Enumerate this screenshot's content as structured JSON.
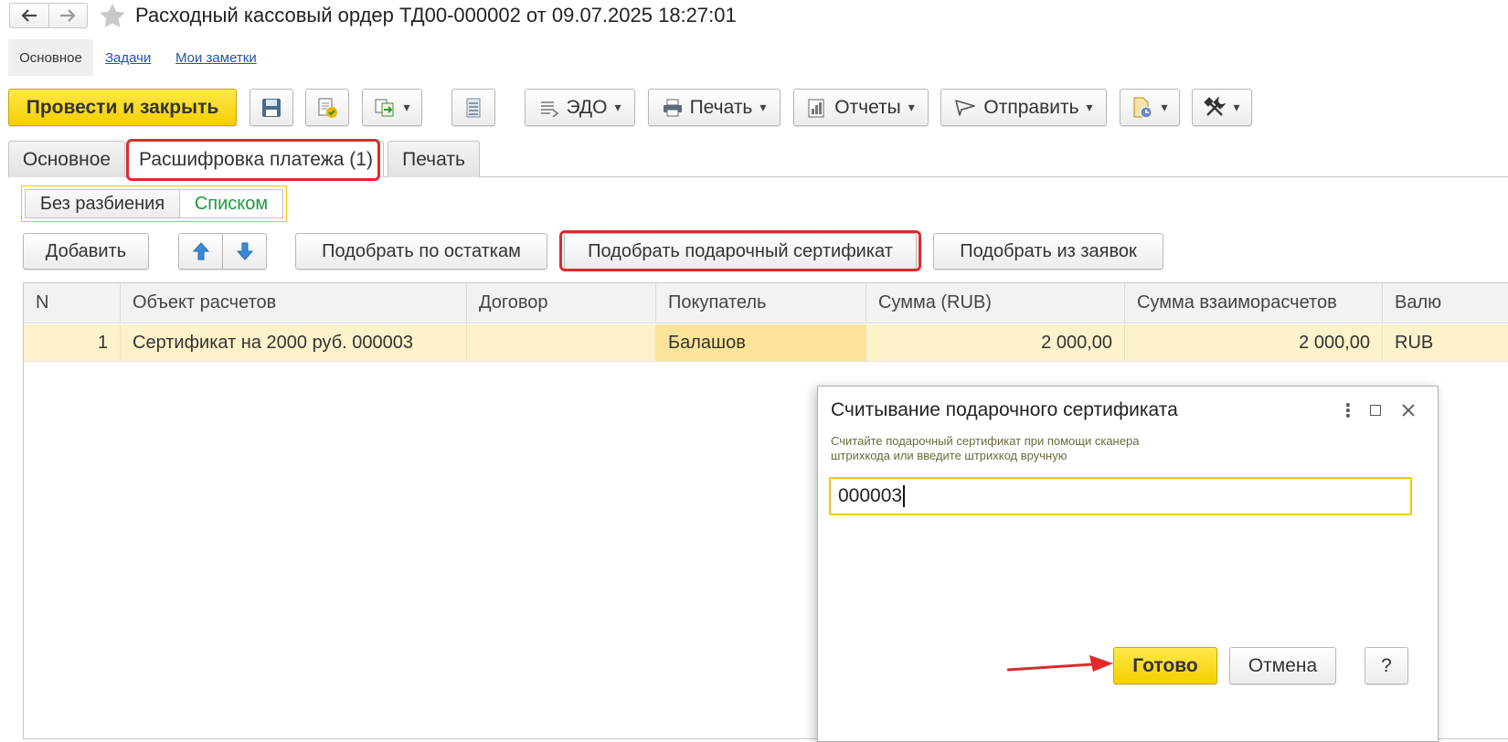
{
  "window": {
    "title": "Расходный кассовый ордер ТД00-000002 от 09.07.2025 18:27:01",
    "back_icon": "arrow-left-icon",
    "forward_icon": "arrow-right-icon",
    "favorite_icon": "star-icon"
  },
  "section_tabs": [
    {
      "label": "Основное"
    },
    {
      "label": "Задачи"
    },
    {
      "label": "Мои заметки"
    }
  ],
  "toolbar": {
    "post_close_label": "Провести и закрыть",
    "edo_label": "ЭДО",
    "print_label": "Печать",
    "reports_label": "Отчеты",
    "send_label": "Отправить"
  },
  "form_tabs": [
    {
      "label": "Основное"
    },
    {
      "label": "Расшифровка платежа (1)"
    },
    {
      "label": "Печать"
    }
  ],
  "mode_switch": {
    "without_split": "Без разбиения",
    "list": "Списком"
  },
  "table_toolbar": {
    "add_label": "Добавить",
    "pick_balance_label": "Подобрать по остаткам",
    "pick_certificate_label": "Подобрать подарочный сертификат",
    "pick_requests_label": "Подобрать из заявок"
  },
  "table": {
    "columns": [
      "N",
      "Объект расчетов",
      "Договор",
      "Покупатель",
      "Сумма (RUB)",
      "Сумма взаиморасчетов",
      "Валю"
    ],
    "rows": [
      {
        "n": "1",
        "object": "Сертификат на 2000 руб. 000003",
        "contract": "",
        "buyer": "Балашов",
        "amount": "2 000,00",
        "settlement": "2 000,00",
        "currency": "RUB"
      }
    ]
  },
  "dialog": {
    "title": "Считывание подарочного сертификата",
    "hint_line1": "Считайте подарочный сертификат при помощи сканера",
    "hint_line2": "штрихкода или введите штрихкод вручную",
    "barcode_value": "000003",
    "ok_label": "Готово",
    "cancel_label": "Отмена",
    "help_label": "?"
  },
  "colors": {
    "accent_yellow": "#f5cf00",
    "highlight_red": "#e0282c",
    "link_blue": "#2255aa",
    "list_green": "#1a9a3a"
  }
}
